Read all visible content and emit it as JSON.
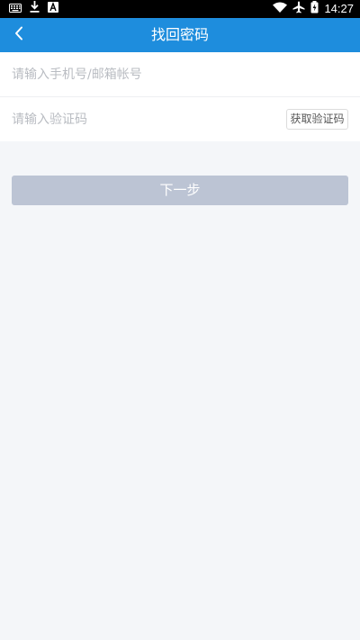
{
  "status_bar": {
    "time": "14:27",
    "left_icons": [
      "keyboard-icon",
      "download-icon",
      "font-icon"
    ],
    "right_icons": [
      "wifi-icon",
      "airplane-icon",
      "battery-icon"
    ]
  },
  "header": {
    "title": "找回密码",
    "back_icon": "chevron-left-icon",
    "background": "#1e8ddd"
  },
  "form": {
    "account_placeholder": "请输入手机号/邮箱帐号",
    "account_value": "",
    "code_placeholder": "请输入验证码",
    "code_value": "",
    "get_code_label": "获取验证码"
  },
  "actions": {
    "next_label": "下一步",
    "next_color": "#bcc4d4"
  }
}
